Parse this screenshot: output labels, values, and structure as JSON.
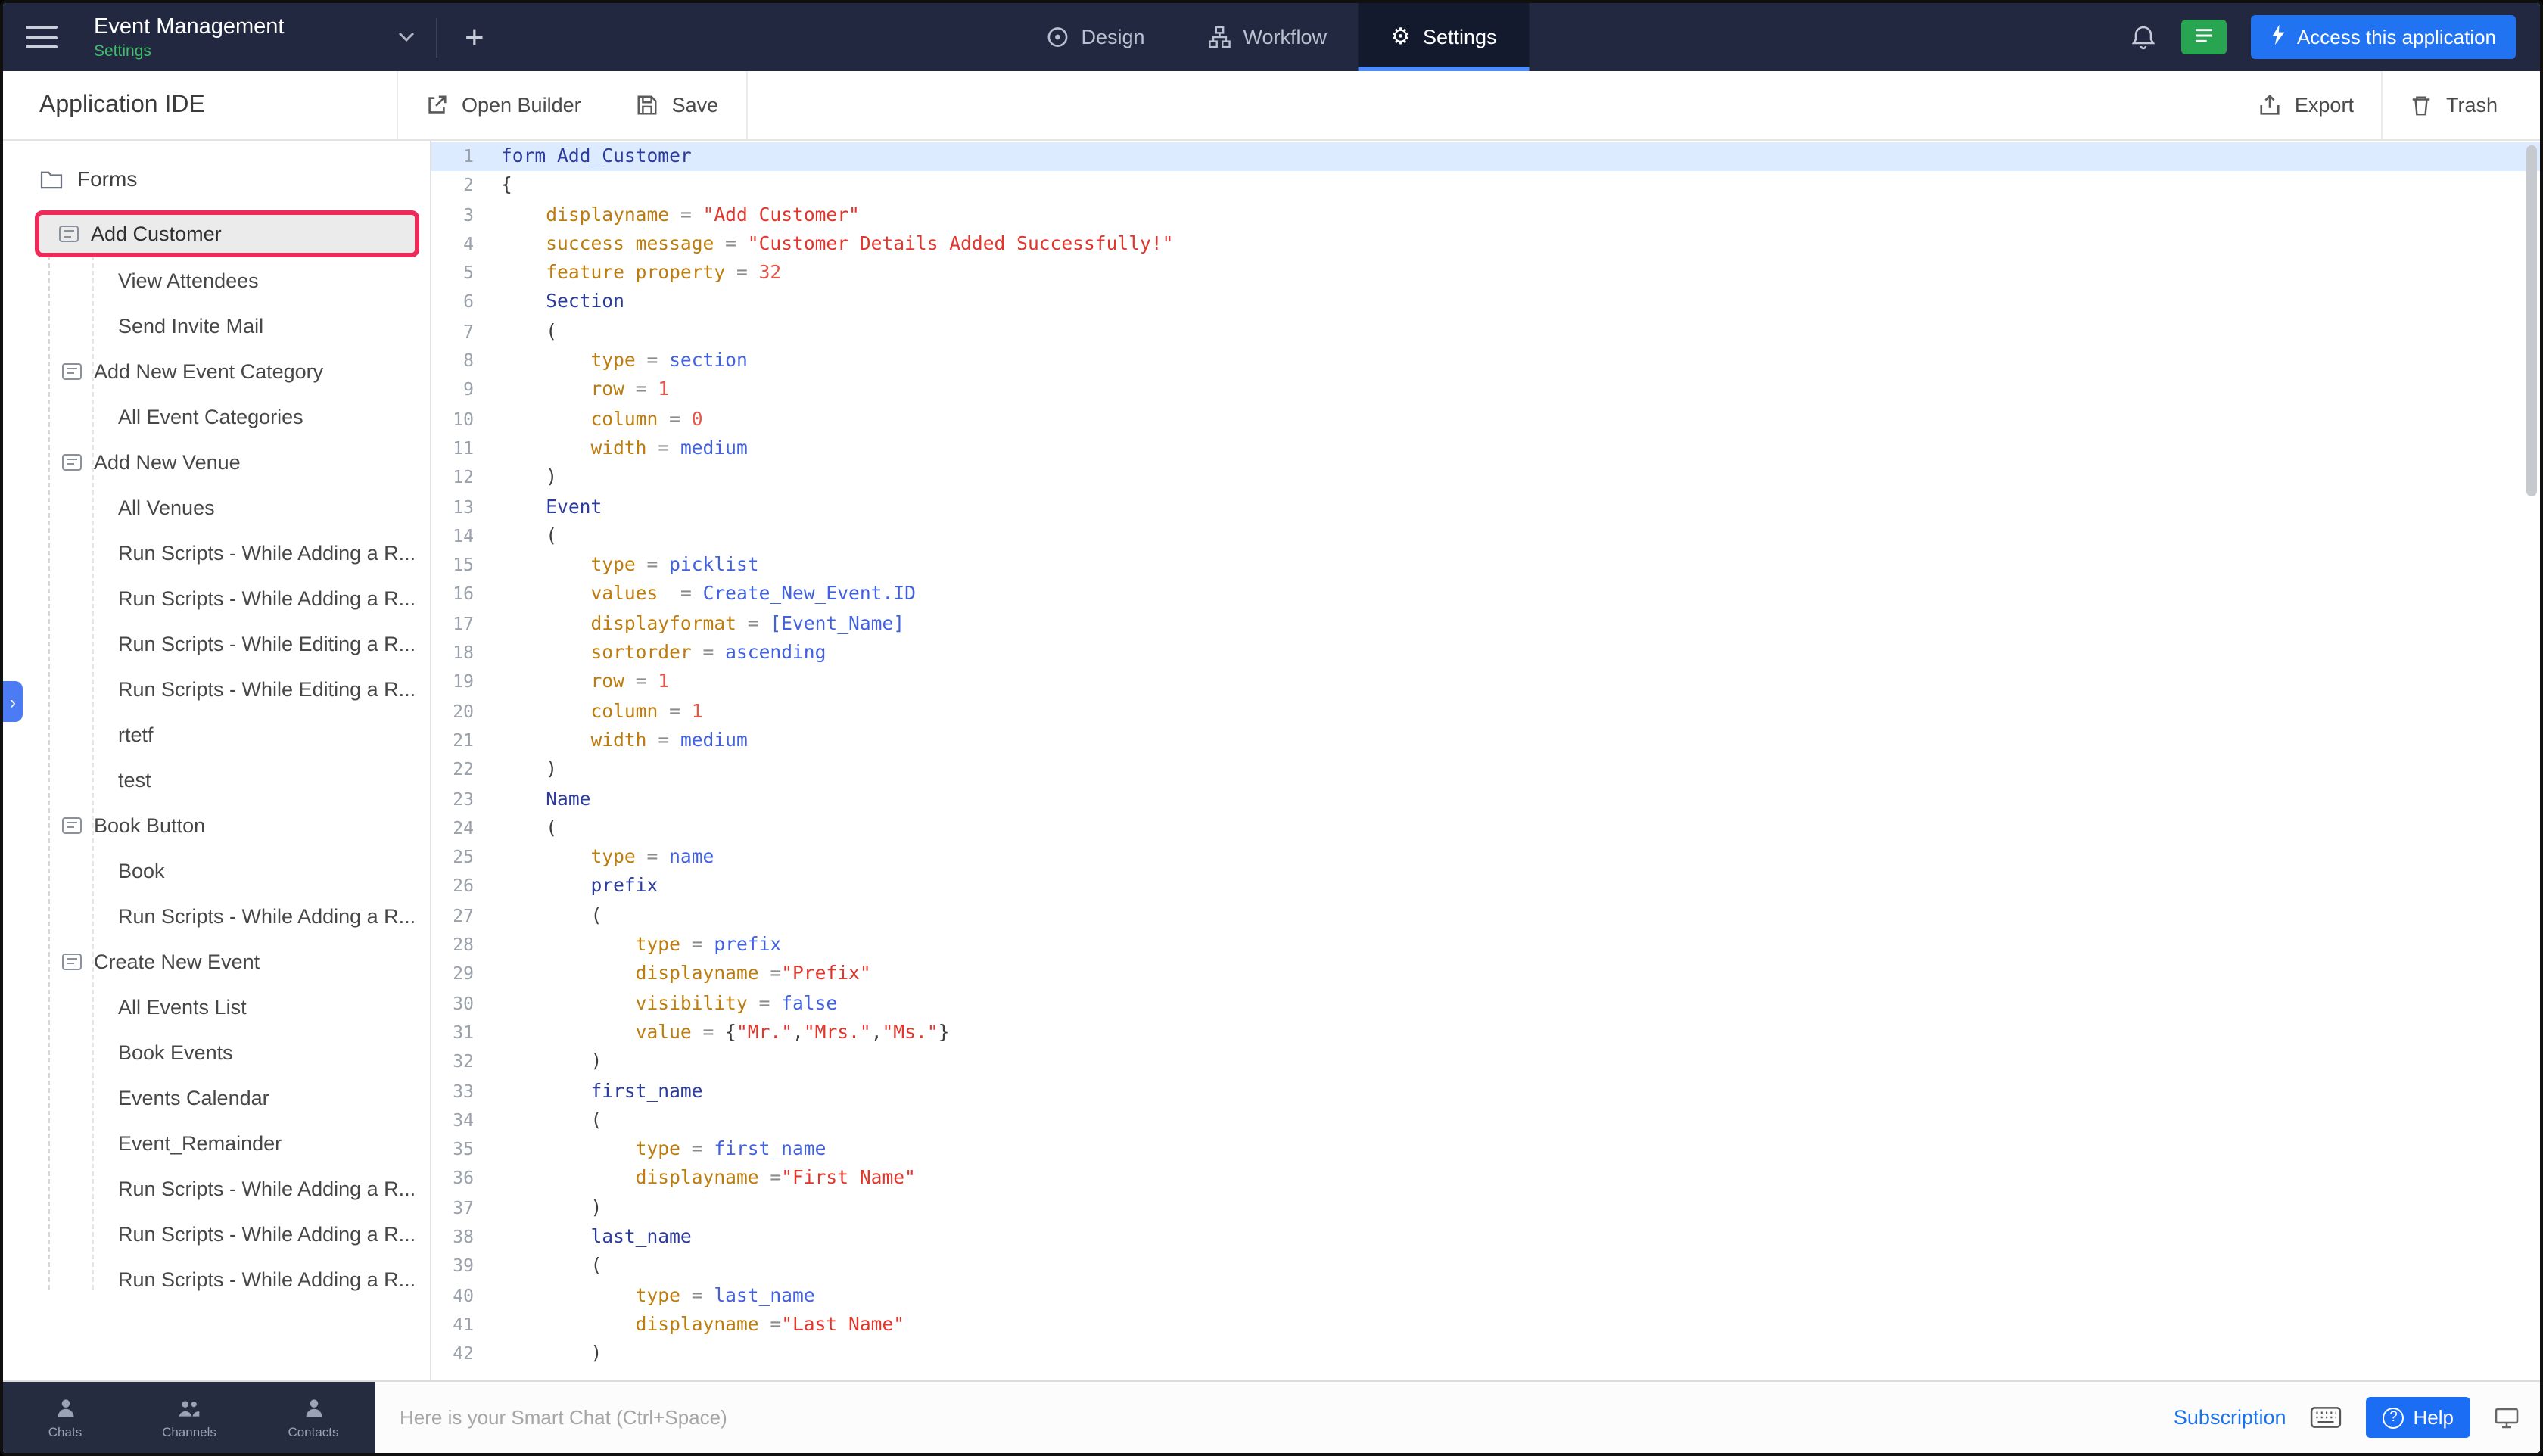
{
  "navbar": {
    "app_title": "Event Management",
    "app_subtitle": "Settings",
    "tabs": [
      {
        "label": "Design",
        "active": false
      },
      {
        "label": "Workflow",
        "active": false
      },
      {
        "label": "Settings",
        "active": true
      }
    ],
    "access_button_label": "Access this application"
  },
  "toolbar": {
    "title": "Application IDE",
    "open_builder_label": "Open Builder",
    "save_label": "Save",
    "export_label": "Export",
    "trash_label": "Trash"
  },
  "sidebar": {
    "root_label": "Forms",
    "items": [
      {
        "label": "Add Customer",
        "type": "form",
        "selected": true
      },
      {
        "label": "View Attendees",
        "type": "child"
      },
      {
        "label": "Send Invite Mail",
        "type": "child"
      },
      {
        "label": "Add New Event Category",
        "type": "form"
      },
      {
        "label": "All Event Categories",
        "type": "child"
      },
      {
        "label": "Add New Venue",
        "type": "form"
      },
      {
        "label": "All Venues",
        "type": "child"
      },
      {
        "label": "Run Scripts - While Adding a R...",
        "type": "child"
      },
      {
        "label": "Run Scripts - While Adding a R...",
        "type": "child"
      },
      {
        "label": "Run Scripts - While Editing a R...",
        "type": "child"
      },
      {
        "label": "Run Scripts - While Editing a R...",
        "type": "child"
      },
      {
        "label": "rtetf",
        "type": "child"
      },
      {
        "label": "test",
        "type": "child"
      },
      {
        "label": "Book Button",
        "type": "form"
      },
      {
        "label": "Book",
        "type": "child"
      },
      {
        "label": "Run Scripts - While Adding a R...",
        "type": "child"
      },
      {
        "label": "Create New Event",
        "type": "form"
      },
      {
        "label": "All Events List",
        "type": "child"
      },
      {
        "label": "Book Events",
        "type": "child"
      },
      {
        "label": "Events Calendar",
        "type": "child"
      },
      {
        "label": "Event_Remainder",
        "type": "child"
      },
      {
        "label": "Run Scripts - While Adding a R...",
        "type": "child"
      },
      {
        "label": "Run Scripts - While Adding a R...",
        "type": "child"
      },
      {
        "label": "Run Scripts - While Adding a R...",
        "type": "child"
      }
    ]
  },
  "editor": {
    "lines": [
      {
        "n": 1,
        "hl": true,
        "t": [
          [
            "decl",
            "form Add_Customer"
          ]
        ]
      },
      {
        "n": 2,
        "t": [
          [
            "brace",
            "{"
          ]
        ]
      },
      {
        "n": 3,
        "t": [
          [
            "prop",
            "    displayname "
          ],
          [
            "op",
            "= "
          ],
          [
            "str",
            "\"Add Customer\""
          ]
        ]
      },
      {
        "n": 4,
        "t": [
          [
            "prop",
            "    success message "
          ],
          [
            "op",
            "= "
          ],
          [
            "str",
            "\"Customer Details Added Successfully!\""
          ]
        ]
      },
      {
        "n": 5,
        "t": [
          [
            "prop",
            "    feature property "
          ],
          [
            "op",
            "= "
          ],
          [
            "num",
            "32"
          ]
        ]
      },
      {
        "n": 6,
        "t": [
          [
            "decl",
            "    Section"
          ]
        ]
      },
      {
        "n": 7,
        "t": [
          [
            "brace",
            "    ("
          ]
        ]
      },
      {
        "n": 8,
        "t": [
          [
            "prop",
            "        type "
          ],
          [
            "op",
            "= "
          ],
          [
            "val",
            "section"
          ]
        ]
      },
      {
        "n": 9,
        "t": [
          [
            "prop",
            "        row "
          ],
          [
            "op",
            "= "
          ],
          [
            "num",
            "1"
          ]
        ]
      },
      {
        "n": 10,
        "t": [
          [
            "prop",
            "        column "
          ],
          [
            "op",
            "= "
          ],
          [
            "num",
            "0"
          ]
        ]
      },
      {
        "n": 11,
        "t": [
          [
            "prop",
            "        width "
          ],
          [
            "op",
            "= "
          ],
          [
            "val",
            "medium"
          ]
        ]
      },
      {
        "n": 12,
        "t": [
          [
            "brace",
            "    )"
          ]
        ]
      },
      {
        "n": 13,
        "t": [
          [
            "decl",
            "    Event"
          ]
        ]
      },
      {
        "n": 14,
        "t": [
          [
            "brace",
            "    ("
          ]
        ]
      },
      {
        "n": 15,
        "t": [
          [
            "prop",
            "        type "
          ],
          [
            "op",
            "= "
          ],
          [
            "val",
            "picklist"
          ]
        ]
      },
      {
        "n": 16,
        "t": [
          [
            "prop",
            "        values  "
          ],
          [
            "op",
            "= "
          ],
          [
            "val",
            "Create_New_Event.ID"
          ]
        ]
      },
      {
        "n": 17,
        "t": [
          [
            "prop",
            "        displayformat "
          ],
          [
            "op",
            "= "
          ],
          [
            "val",
            "[Event_Name]"
          ]
        ]
      },
      {
        "n": 18,
        "t": [
          [
            "prop",
            "        sortorder "
          ],
          [
            "op",
            "= "
          ],
          [
            "val",
            "ascending"
          ]
        ]
      },
      {
        "n": 19,
        "t": [
          [
            "prop",
            "        row "
          ],
          [
            "op",
            "= "
          ],
          [
            "num",
            "1"
          ]
        ]
      },
      {
        "n": 20,
        "t": [
          [
            "prop",
            "        column "
          ],
          [
            "op",
            "= "
          ],
          [
            "num",
            "1"
          ]
        ]
      },
      {
        "n": 21,
        "t": [
          [
            "prop",
            "        width "
          ],
          [
            "op",
            "= "
          ],
          [
            "val",
            "medium"
          ]
        ]
      },
      {
        "n": 22,
        "t": [
          [
            "brace",
            "    )"
          ]
        ]
      },
      {
        "n": 23,
        "t": [
          [
            "decl",
            "    Name"
          ]
        ]
      },
      {
        "n": 24,
        "t": [
          [
            "brace",
            "    ("
          ]
        ]
      },
      {
        "n": 25,
        "t": [
          [
            "prop",
            "        type "
          ],
          [
            "op",
            "= "
          ],
          [
            "val",
            "name"
          ]
        ]
      },
      {
        "n": 26,
        "t": [
          [
            "decl",
            "        prefix"
          ]
        ]
      },
      {
        "n": 27,
        "t": [
          [
            "brace",
            "        ("
          ]
        ]
      },
      {
        "n": 28,
        "t": [
          [
            "prop",
            "            type "
          ],
          [
            "op",
            "= "
          ],
          [
            "val",
            "prefix"
          ]
        ]
      },
      {
        "n": 29,
        "t": [
          [
            "prop",
            "            displayname "
          ],
          [
            "op",
            "="
          ],
          [
            "str",
            "\"Prefix\""
          ]
        ]
      },
      {
        "n": 30,
        "t": [
          [
            "prop",
            "            visibility "
          ],
          [
            "op",
            "= "
          ],
          [
            "val",
            "false"
          ]
        ]
      },
      {
        "n": 31,
        "t": [
          [
            "prop",
            "            value "
          ],
          [
            "op",
            "= "
          ],
          [
            "brace",
            "{"
          ],
          [
            "str",
            "\"Mr.\""
          ],
          [
            "brace",
            ","
          ],
          [
            "str",
            "\"Mrs.\""
          ],
          [
            "brace",
            ","
          ],
          [
            "str",
            "\"Ms.\""
          ],
          [
            "brace",
            "}"
          ]
        ]
      },
      {
        "n": 32,
        "t": [
          [
            "brace",
            "        )"
          ]
        ]
      },
      {
        "n": 33,
        "t": [
          [
            "decl",
            "        first_name"
          ]
        ]
      },
      {
        "n": 34,
        "t": [
          [
            "brace",
            "        ("
          ]
        ]
      },
      {
        "n": 35,
        "t": [
          [
            "prop",
            "            type "
          ],
          [
            "op",
            "= "
          ],
          [
            "val",
            "first_name"
          ]
        ]
      },
      {
        "n": 36,
        "t": [
          [
            "prop",
            "            displayname "
          ],
          [
            "op",
            "="
          ],
          [
            "str",
            "\"First Name\""
          ]
        ]
      },
      {
        "n": 37,
        "t": [
          [
            "brace",
            "        )"
          ]
        ]
      },
      {
        "n": 38,
        "t": [
          [
            "decl",
            "        last_name"
          ]
        ]
      },
      {
        "n": 39,
        "t": [
          [
            "brace",
            "        ("
          ]
        ]
      },
      {
        "n": 40,
        "t": [
          [
            "prop",
            "            type "
          ],
          [
            "op",
            "= "
          ],
          [
            "val",
            "last_name"
          ]
        ]
      },
      {
        "n": 41,
        "t": [
          [
            "prop",
            "            displayname "
          ],
          [
            "op",
            "="
          ],
          [
            "str",
            "\"Last Name\""
          ]
        ]
      },
      {
        "n": 42,
        "t": [
          [
            "brace",
            "        )"
          ]
        ]
      }
    ]
  },
  "statusbar": {
    "chat_tabs": [
      "Chats",
      "Channels",
      "Contacts"
    ],
    "smart_chat_placeholder": "Here is your Smart Chat (Ctrl+Space)",
    "subscription_label": "Subscription",
    "help_label": "Help"
  },
  "icons": {
    "plus": "+",
    "gear": "⚙",
    "chevron_right": "›",
    "question": "?"
  },
  "colors": {
    "selection_outline": "#ee2a5b",
    "active_tab_underline": "#4d8cff",
    "access_button_bg": "#2173f2",
    "help_button_bg": "#1b6ef3",
    "green_button_bg": "#27a551",
    "subtitle_green": "#40bf6b",
    "line_highlight": "#dcebff"
  }
}
